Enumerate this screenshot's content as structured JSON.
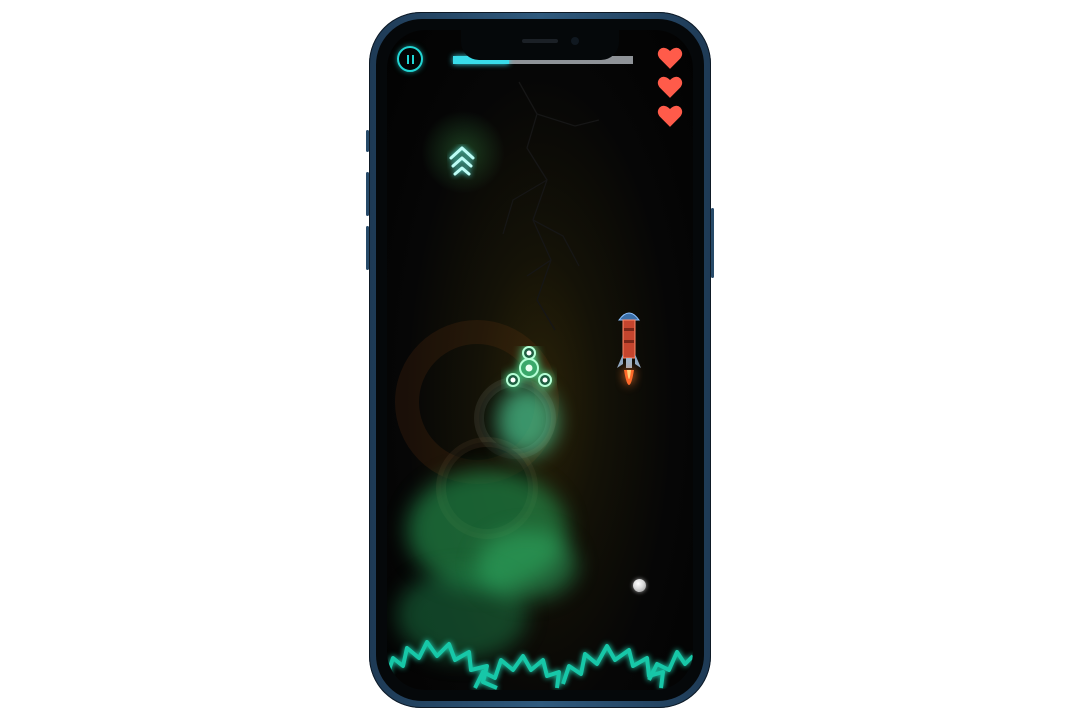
{
  "game": {
    "level_progress": 0.31,
    "lives": 3,
    "colors": {
      "accent": "#22d6d4",
      "heart": "#ff5b4a",
      "progress_fill": "#39dcea",
      "progress_track": "#8f9398",
      "smoke": "#2fbf6e",
      "hazard": "#17c7a8"
    },
    "hud": {
      "pause_icon": "pause-icon",
      "heart_icon": "heart-icon"
    },
    "entities": {
      "powerup_icon": "triple-chevron-up-icon",
      "player": "spinner-ship",
      "enemy": "rocket",
      "pickup": "white-orb",
      "hazard": "saw-blade-row"
    }
  }
}
